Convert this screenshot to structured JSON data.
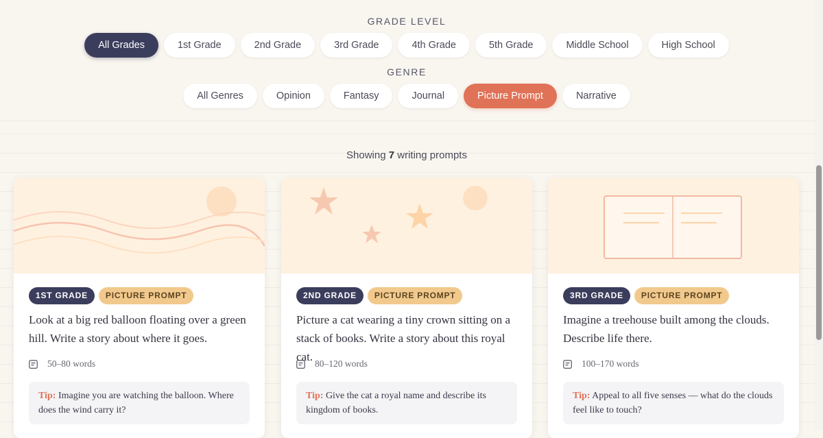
{
  "filters": {
    "grade": {
      "label": "GRADE LEVEL",
      "options": [
        "All Grades",
        "1st Grade",
        "2nd Grade",
        "3rd Grade",
        "4th Grade",
        "5th Grade",
        "Middle School",
        "High School"
      ],
      "selected": "All Grades"
    },
    "genre": {
      "label": "GENRE",
      "options": [
        "All Genres",
        "Opinion",
        "Fantasy",
        "Journal",
        "Picture Prompt",
        "Narrative"
      ],
      "selected": "Picture Prompt"
    }
  },
  "results": {
    "prefix": "Showing",
    "count": "7",
    "suffix": "writing prompts"
  },
  "cards": [
    {
      "grade": "1ST GRADE",
      "genre": "PICTURE PROMPT",
      "prompt": "Look at a big red balloon floating over a green hill. Write a story about where it goes.",
      "words": "50–80 words",
      "tip_label": "Tip:",
      "tip": "Imagine you are watching the balloon. Where does the wind carry it?",
      "illustration": "waves-sun-icon"
    },
    {
      "grade": "2ND GRADE",
      "genre": "PICTURE PROMPT",
      "prompt": "Picture a cat wearing a tiny crown sitting on a stack of books. Write a story about this royal cat.",
      "words": "80–120 words",
      "tip_label": "Tip:",
      "tip": "Give the cat a royal name and describe its kingdom of books.",
      "illustration": "stars-moon-icon"
    },
    {
      "grade": "3RD GRADE",
      "genre": "PICTURE PROMPT",
      "prompt": "Imagine a treehouse built among the clouds. Describe life there.",
      "words": "100–170 words",
      "tip_label": "Tip:",
      "tip": "Appeal to all five senses — what do the clouds feel like to touch?",
      "illustration": "open-book-icon"
    }
  ],
  "colors": {
    "dark": "#3b3d5c",
    "accent": "#e07257",
    "genre_badge": "#f2c98d",
    "hero": "#fff1e0"
  }
}
